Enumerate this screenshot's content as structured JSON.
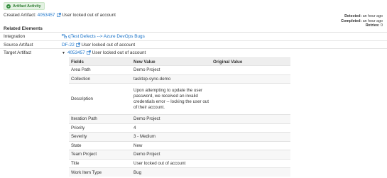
{
  "badge": {
    "label": "Artifact Activity",
    "icon": "check-circle-icon",
    "color": "#2e7d32"
  },
  "created": {
    "prefix": "Created Artifact:",
    "artifact_id": "4053457",
    "title": "User locked out of account"
  },
  "meta": {
    "detected_label": "Detected:",
    "detected_value": "an hour ago",
    "completed_label": "Completed:",
    "completed_value": "an hour ago",
    "retries_label": "Retries:",
    "retries_value": "0"
  },
  "related": {
    "title": "Related Elements",
    "integration_label": "Integration",
    "integration_value": "qTest Defects --> Azure DevOps Bugs",
    "source_label": "Source Artifact",
    "source_id": "DF-22",
    "source_title": "User locked out of account",
    "target_label": "Target Artifact",
    "target_id": "4053457",
    "target_title": "User locked out of account"
  },
  "table": {
    "headers": [
      "Fields",
      "New Value",
      "Original Value"
    ],
    "rows": [
      {
        "field": "Area Path",
        "new_value": "Demo Project",
        "original_value": ""
      },
      {
        "field": "Collection",
        "new_value": "tasktop-sync-demo",
        "original_value": ""
      },
      {
        "field": "Description",
        "new_value": "Upon attempting to update the user password, we received an invalid credentials error -- locking the user out of their account.",
        "original_value": ""
      },
      {
        "field": "Iteration Path",
        "new_value": "Demo Project",
        "original_value": ""
      },
      {
        "field": "Priority",
        "new_value": "4",
        "original_value": ""
      },
      {
        "field": "Severity",
        "new_value": "3 - Medium",
        "original_value": ""
      },
      {
        "field": "State",
        "new_value": "New",
        "original_value": ""
      },
      {
        "field": "Team Project",
        "new_value": "Demo Project",
        "original_value": ""
      },
      {
        "field": "Title",
        "new_value": "User locked out of account",
        "original_value": ""
      },
      {
        "field": "Work Item Type",
        "new_value": "Bug",
        "original_value": ""
      }
    ]
  },
  "colors": {
    "link": "#1a73c9",
    "badge_bg": "#e3f1e2",
    "header_bg": "#eeeeee"
  }
}
